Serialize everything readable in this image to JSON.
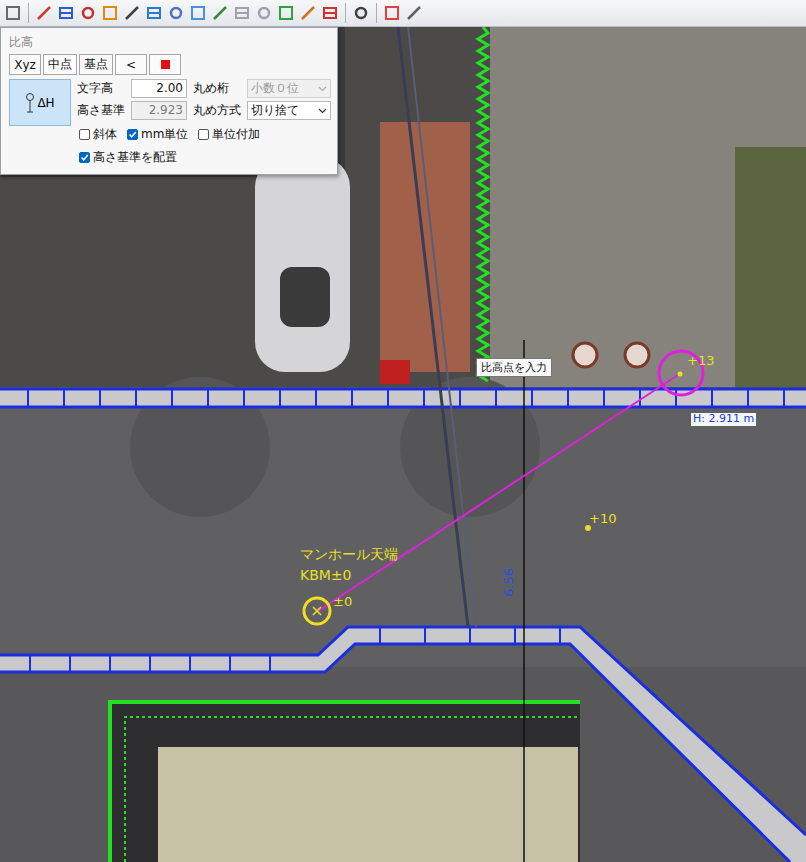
{
  "panel": {
    "title": "比高",
    "modeButtons": [
      {
        "label": "Xyz",
        "selected": false
      },
      {
        "label": "中点",
        "selected": false
      },
      {
        "label": "基点",
        "selected": false
      },
      {
        "label": "<",
        "selected": false
      }
    ],
    "tool": {
      "label": "ΔH",
      "selected": true
    },
    "fields": [
      {
        "label": "文字高",
        "value": "2.00",
        "disabled": false,
        "kind": "input"
      },
      {
        "label": "丸め桁",
        "value": "小数０位",
        "disabled": true,
        "kind": "select"
      },
      {
        "label": "高さ基準",
        "value": "2.923",
        "disabled": true,
        "kind": "input"
      },
      {
        "label": "丸め方式",
        "value": "切り捨て",
        "disabled": false,
        "kind": "select"
      }
    ],
    "checkboxes": [
      {
        "label": "斜体",
        "checked": false
      },
      {
        "label": "mm単位",
        "checked": true
      },
      {
        "label": "単位付加",
        "checked": false
      },
      {
        "label": "高さ基準を配置",
        "checked": true
      }
    ]
  },
  "canvas": {
    "tooltip": "比高点を入力",
    "labels": [
      {
        "text": "+13",
        "kind": "point",
        "color": "#e8e020"
      },
      {
        "text": "H: 2.911 m",
        "kind": "value",
        "color": "#2040d0"
      },
      {
        "text": "+10",
        "kind": "point",
        "color": "#e8e020"
      },
      {
        "text": "マンホール天端",
        "kind": "note",
        "color": "#e8e020"
      },
      {
        "text": "KBM±0",
        "kind": "note",
        "color": "#e8e020"
      },
      {
        "text": "±0",
        "kind": "point",
        "color": "#e8e020"
      },
      {
        "text": "6.56",
        "kind": "dimension",
        "color": "#2a4fd8"
      }
    ]
  }
}
